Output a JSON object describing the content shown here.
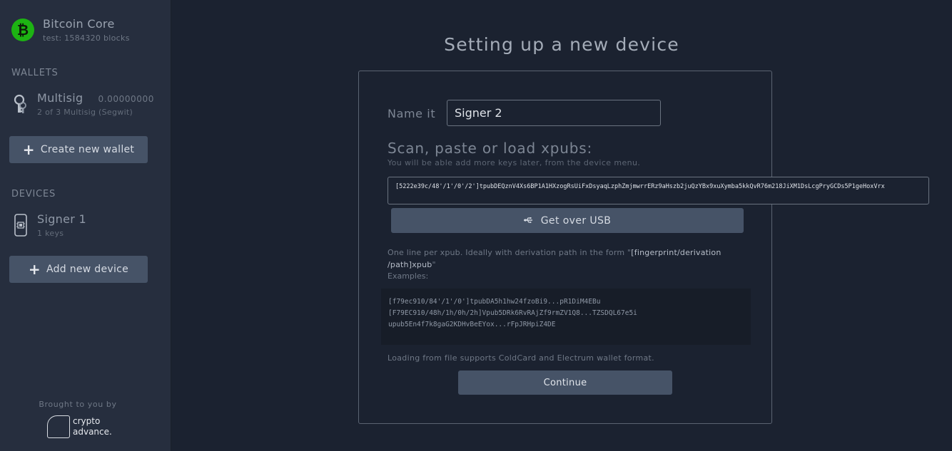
{
  "node": {
    "name": "Bitcoin Core",
    "status": "test: 1584320 blocks",
    "logo_symbol": "₿",
    "logo_color": "#1db313"
  },
  "sidebar": {
    "wallets_label": "WALLETS",
    "wallets": [
      {
        "name": "Multisig",
        "amount": "0.00000000",
        "subtitle": "2 of 3 Multisig (Segwit)",
        "icon": "keys-icon"
      }
    ],
    "create_wallet_label": "Create new wallet",
    "devices_label": "DEVICES",
    "devices": [
      {
        "name": "Signer 1",
        "subtitle": "1 keys",
        "icon": "device-icon"
      }
    ],
    "add_device_label": "Add new device",
    "brought_by": "Brought to you by",
    "brand_line1": "crypto",
    "brand_line2": "advance."
  },
  "main": {
    "title": "Setting up a new device",
    "name_label": "Name it",
    "name_value": "Signer 2",
    "scan_title": "Scan, paste or load xpubs:",
    "scan_subtitle": "You will be able add more keys later, from the device menu.",
    "xpub_value": "[5222e39c/48'/1'/0'/2']tpubDEQznV4Xs6BP1A1HXzogRsUiFxDsyaqLzphZmjmwrrERz9aHszb2juQzYBx9xuXymba5kkQvR76m218JiXM1DsLcgPryGCDs5P1geHoxVrx",
    "usb_button": "Get over USB",
    "hint_prefix": "One line per xpub. Ideally with derivation path in the form \"",
    "hint_highlight": "[fingerprint/derivation /path]xpub",
    "hint_suffix": "\"",
    "examples_label": "Examples:",
    "examples": [
      "[f79ec910/84'/1'/0']tpubDA5h1hw24fzoBi9...pR1DiM4EBu",
      "[F79EC910/48h/1h/0h/2h]Vpub5DRk6RvRAjZf9rmZV1Q8...TZSDQL67e5i",
      "upub5En4f7k8gaG2KDHvBeEYox...rFpJRHpiZ4DE"
    ],
    "load_note": "Loading from file supports ColdCard and Electrum wallet format.",
    "continue_button": "Continue"
  }
}
